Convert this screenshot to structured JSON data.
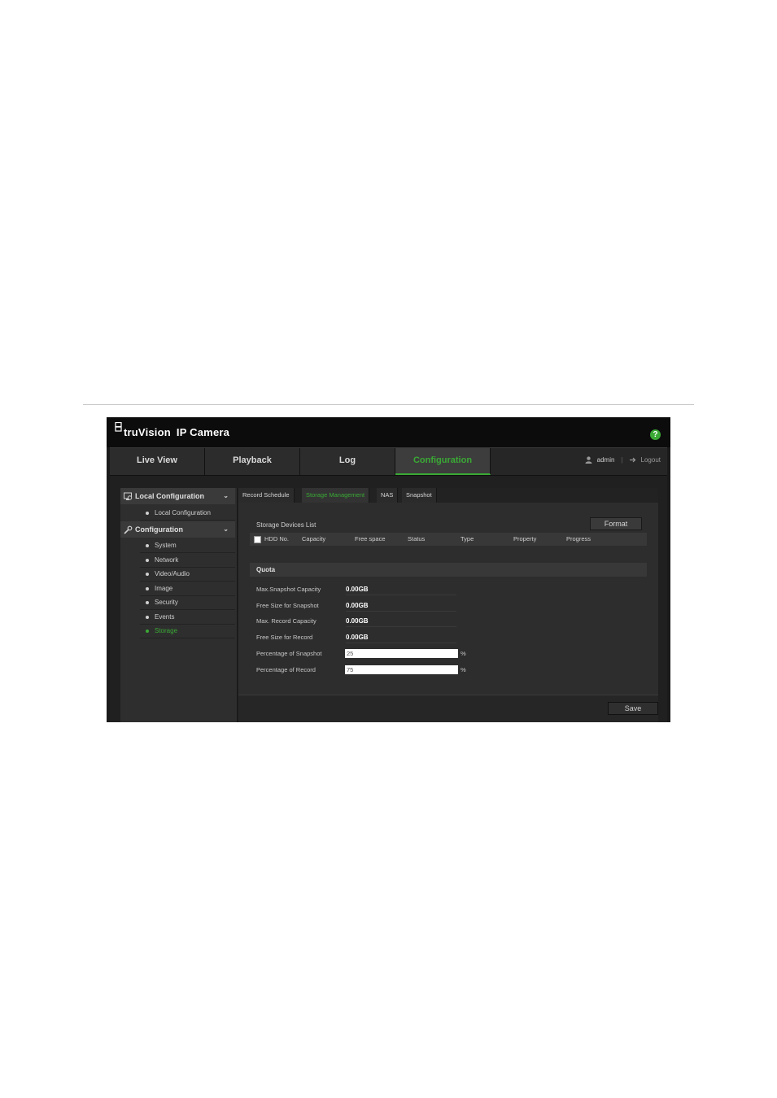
{
  "app": {
    "brand": "truVision",
    "product": "IP Camera"
  },
  "nav": {
    "tabs": [
      {
        "label": "Live View"
      },
      {
        "label": "Playback"
      },
      {
        "label": "Log"
      },
      {
        "label": "Configuration"
      }
    ],
    "user": "admin",
    "separator": "|",
    "logout": "Logout"
  },
  "sidebar": {
    "local_config": {
      "label": "Local Configuration",
      "items": [
        "Local Configuration"
      ]
    },
    "configuration": {
      "label": "Configuration",
      "items": [
        "System",
        "Network",
        "Video/Audio",
        "Image",
        "Security",
        "Events",
        "Storage"
      ]
    }
  },
  "subtabs": [
    "Record Schedule",
    "Storage Management",
    "NAS",
    "Snapshot"
  ],
  "storage": {
    "list_title": "Storage Devices List",
    "format_button": "Format",
    "columns": [
      "HDD No.",
      "Capacity",
      "Free space",
      "Status",
      "Type",
      "Property",
      "Progress"
    ]
  },
  "quota": {
    "title": "Quota",
    "fields": [
      {
        "label": "Max.Snapshot Capacity",
        "value": "0.00GB"
      },
      {
        "label": "Free Size for Snapshot",
        "value": "0.00GB"
      },
      {
        "label": "Max. Record Capacity",
        "value": "0.00GB"
      },
      {
        "label": "Free Size for Record",
        "value": "0.00GB"
      }
    ],
    "percent_snapshot": {
      "label": "Percentage of Snapshot",
      "value": "25",
      "unit": "%"
    },
    "percent_record": {
      "label": "Percentage of Record",
      "value": "75",
      "unit": "%"
    }
  },
  "save_button": "Save",
  "colors": {
    "accent": "#3aa935",
    "background": "#1b1b1b"
  }
}
